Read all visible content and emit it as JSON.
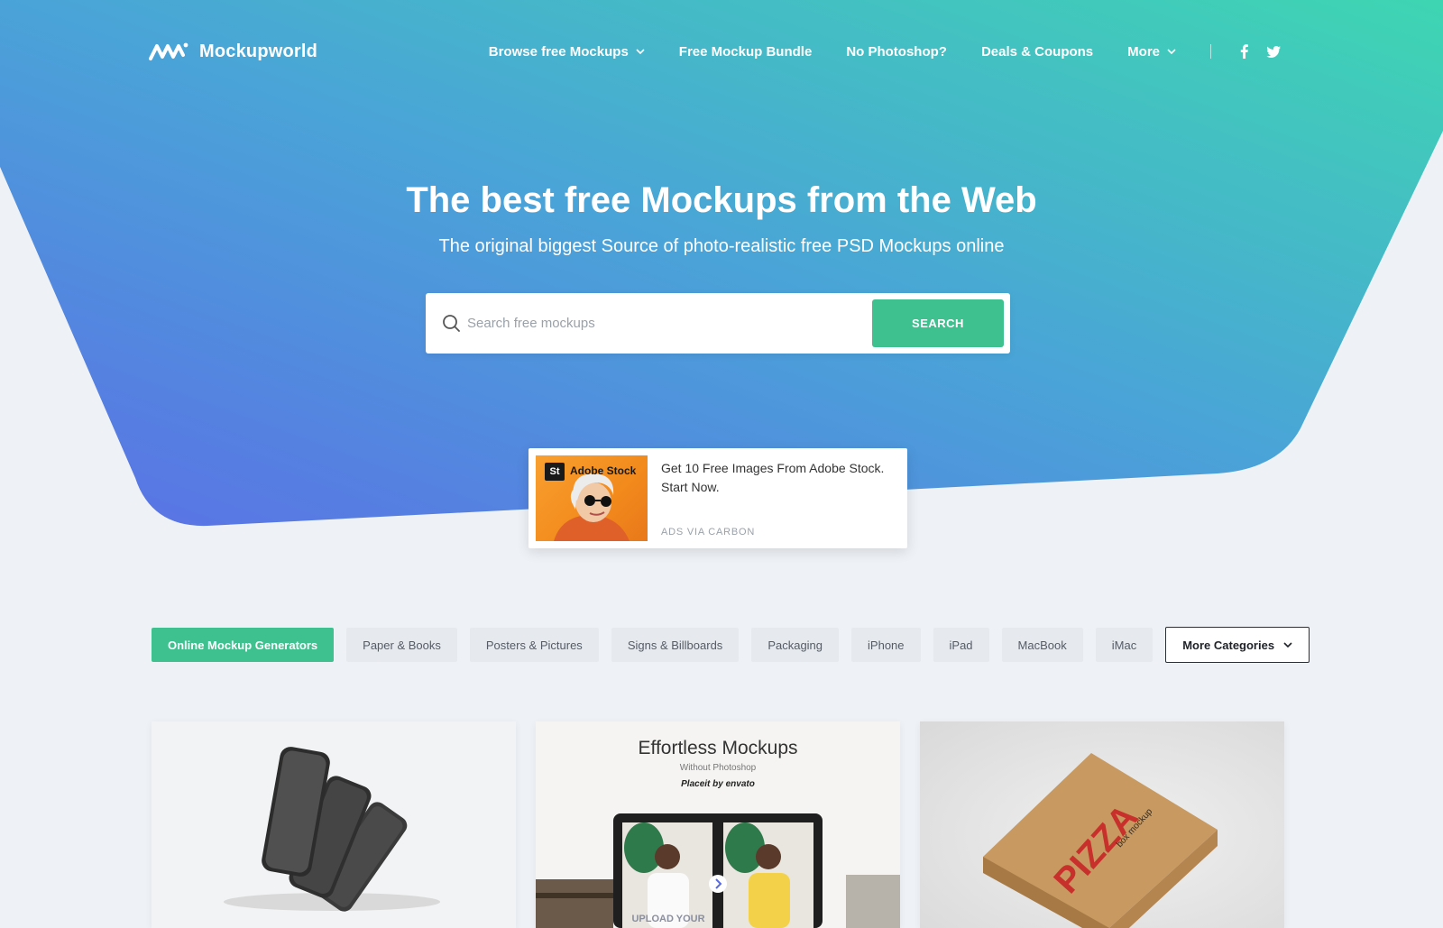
{
  "brand": {
    "name": "Mockupworld"
  },
  "nav": {
    "items": [
      {
        "label": "Browse free Mockups",
        "dropdown": true
      },
      {
        "label": "Free Mockup Bundle",
        "dropdown": false
      },
      {
        "label": "No Photoshop?",
        "dropdown": false
      },
      {
        "label": "Deals & Coupons",
        "dropdown": false
      },
      {
        "label": "More",
        "dropdown": true
      }
    ],
    "social": [
      "facebook-icon",
      "twitter-icon"
    ]
  },
  "hero": {
    "title": "The best free Mockups from the Web",
    "subtitle": "The original biggest Source of photo-realistic free PSD Mockups online"
  },
  "search": {
    "placeholder": "Search free mockups",
    "button_label": "SEARCH"
  },
  "ad": {
    "brand": "Adobe Stock",
    "brand_badge": "St",
    "text": "Get 10 Free Images From Adobe Stock. Start Now.",
    "via": "ADS VIA CARBON"
  },
  "categories": {
    "items": [
      {
        "label": "Online Mockup Generators",
        "active": true
      },
      {
        "label": "Paper & Books",
        "active": false
      },
      {
        "label": "Posters & Pictures",
        "active": false
      },
      {
        "label": "Signs & Billboards",
        "active": false
      },
      {
        "label": "Packaging",
        "active": false
      },
      {
        "label": "iPhone",
        "active": false
      },
      {
        "label": "iPad",
        "active": false
      },
      {
        "label": "MacBook",
        "active": false
      },
      {
        "label": "iMac",
        "active": false
      }
    ],
    "more_label": "More Categories"
  },
  "cards": {
    "card2": {
      "title": "Effortless Mockups",
      "subtitle": "Without Photoshop",
      "brand": "Placeit by envato",
      "screen_text": "UPLOAD YOUR"
    },
    "card3": {
      "box_text": "PIZZA",
      "box_sub": "box mockup"
    }
  },
  "colors": {
    "accent_green": "#3fc18f",
    "hero_gradient_start": "#5a7ee8",
    "hero_gradient_end": "#3ed2b4",
    "page_bg": "#eef2f6"
  }
}
